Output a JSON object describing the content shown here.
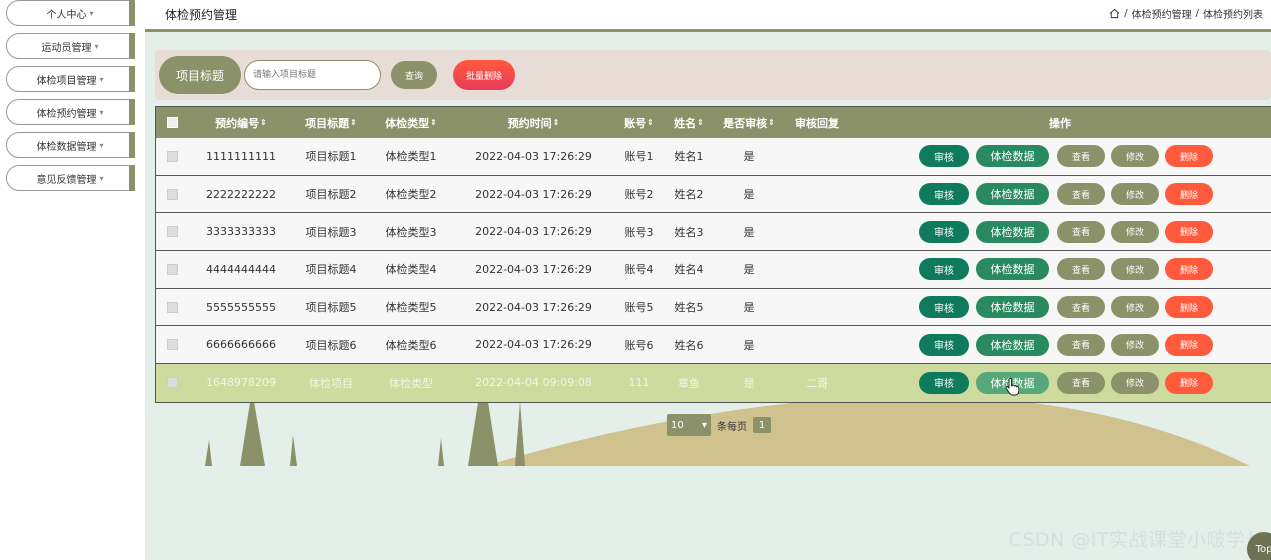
{
  "sidebar": {
    "items": [
      {
        "label": "个人中心"
      },
      {
        "label": "运动员管理"
      },
      {
        "label": "体检项目管理"
      },
      {
        "label": "体检预约管理"
      },
      {
        "label": "体检数据管理"
      },
      {
        "label": "意见反馈管理"
      }
    ],
    "caret": "▾"
  },
  "header": {
    "title": "体检预约管理",
    "breadcrumb": [
      "体检预约管理",
      "体检预约列表"
    ],
    "separator": "/"
  },
  "search": {
    "label": "项目标题",
    "placeholder": "请输入项目标题",
    "query_label": "查询",
    "batch_delete_label": "批量删除"
  },
  "table": {
    "columns": [
      "预约编号",
      "项目标题",
      "体检类型",
      "预约时间",
      "账号",
      "姓名",
      "是否审核",
      "审核回复",
      "操作"
    ],
    "sort_icon": "⇕",
    "rows": [
      {
        "id": "1111111111",
        "title": "项目标题1",
        "type": "体检类型1",
        "time": "2022-04-03 17:26:29",
        "account": "账号1",
        "name": "姓名1",
        "audited": "是",
        "reply": ""
      },
      {
        "id": "2222222222",
        "title": "项目标题2",
        "type": "体检类型2",
        "time": "2022-04-03 17:26:29",
        "account": "账号2",
        "name": "姓名2",
        "audited": "是",
        "reply": ""
      },
      {
        "id": "3333333333",
        "title": "项目标题3",
        "type": "体检类型3",
        "time": "2022-04-03 17:26:29",
        "account": "账号3",
        "name": "姓名3",
        "audited": "是",
        "reply": ""
      },
      {
        "id": "4444444444",
        "title": "项目标题4",
        "type": "体检类型4",
        "time": "2022-04-03 17:26:29",
        "account": "账号4",
        "name": "姓名4",
        "audited": "是",
        "reply": ""
      },
      {
        "id": "5555555555",
        "title": "项目标题5",
        "type": "体检类型5",
        "time": "2022-04-03 17:26:29",
        "account": "账号5",
        "name": "姓名5",
        "audited": "是",
        "reply": ""
      },
      {
        "id": "6666666666",
        "title": "项目标题6",
        "type": "体检类型6",
        "time": "2022-04-03 17:26:29",
        "account": "账号6",
        "name": "姓名6",
        "audited": "是",
        "reply": ""
      },
      {
        "id": "1648978209",
        "title": "体检项目",
        "type": "体检类型",
        "time": "2022-04-04 09:09:08",
        "account": "111",
        "name": "章鱼",
        "audited": "是",
        "reply": "二哥",
        "highlighted": true
      }
    ],
    "actions": {
      "audit": "审核",
      "data": "体检数据",
      "view": "查看",
      "edit": "修改",
      "delete": "删除"
    }
  },
  "pagination": {
    "page_size": "10",
    "page_size_label": "条每页",
    "current_page": "1"
  },
  "watermark": "CSDN @IT实战课堂小啵学长",
  "top_button": "Top",
  "colors": {
    "primary": "#8b9168",
    "audit": "#0f7a5c",
    "data": "#2a8a5f",
    "delete": "#ff5a3c",
    "highlight_row": "#cddc9e"
  }
}
